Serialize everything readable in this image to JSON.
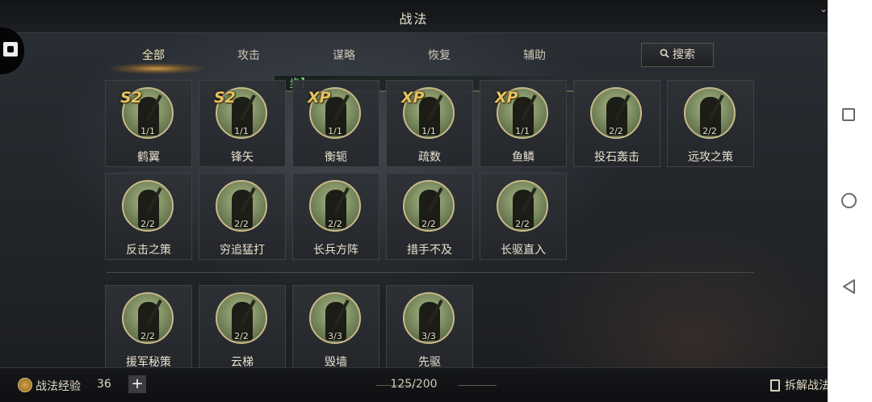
{
  "header": {
    "title": "战法"
  },
  "tabs": [
    {
      "label": "全部",
      "active": true
    },
    {
      "label": "攻击"
    },
    {
      "label": "谋略"
    },
    {
      "label": "恢复"
    },
    {
      "label": "辅助"
    }
  ],
  "search": {
    "label": "搜索",
    "icon": "search-icon"
  },
  "hint": {
    "text": "步】"
  },
  "skills_row1": [
    {
      "tag": "S2",
      "level": "1/1",
      "name": "鹤翼"
    },
    {
      "tag": "S2",
      "level": "1/1",
      "name": "锋矢"
    },
    {
      "tag": "XP",
      "level": "1/1",
      "name": "衡轭"
    },
    {
      "tag": "XP",
      "level": "1/1",
      "name": "疏数"
    },
    {
      "tag": "XP",
      "level": "1/1",
      "name": "鱼鳞"
    },
    {
      "tag": "",
      "level": "2/2",
      "name": "投石轰击"
    },
    {
      "tag": "",
      "level": "2/2",
      "name": "远攻之策"
    }
  ],
  "skills_row2": [
    {
      "level": "2/2",
      "name": "反击之策"
    },
    {
      "level": "2/2",
      "name": "穷追猛打"
    },
    {
      "level": "2/2",
      "name": "长兵方阵"
    },
    {
      "level": "2/2",
      "name": "措手不及"
    },
    {
      "level": "2/2",
      "name": "长驱直入"
    }
  ],
  "skills_row3": [
    {
      "level": "2/2",
      "name": "援军秘策"
    },
    {
      "level": "2/2",
      "name": "云梯"
    },
    {
      "level": "3/3",
      "name": "毁墙"
    },
    {
      "level": "3/3",
      "name": "先驱"
    }
  ],
  "footer": {
    "exp_label": "战法经验",
    "exp_value": "36",
    "plus": "+",
    "count": "125/200",
    "decompose_label": "拆解战法"
  },
  "colors": {
    "accent_gold": "#e6c25c",
    "hint_green": "#7bd66e",
    "active_tab_glow": "#e6aa46"
  }
}
